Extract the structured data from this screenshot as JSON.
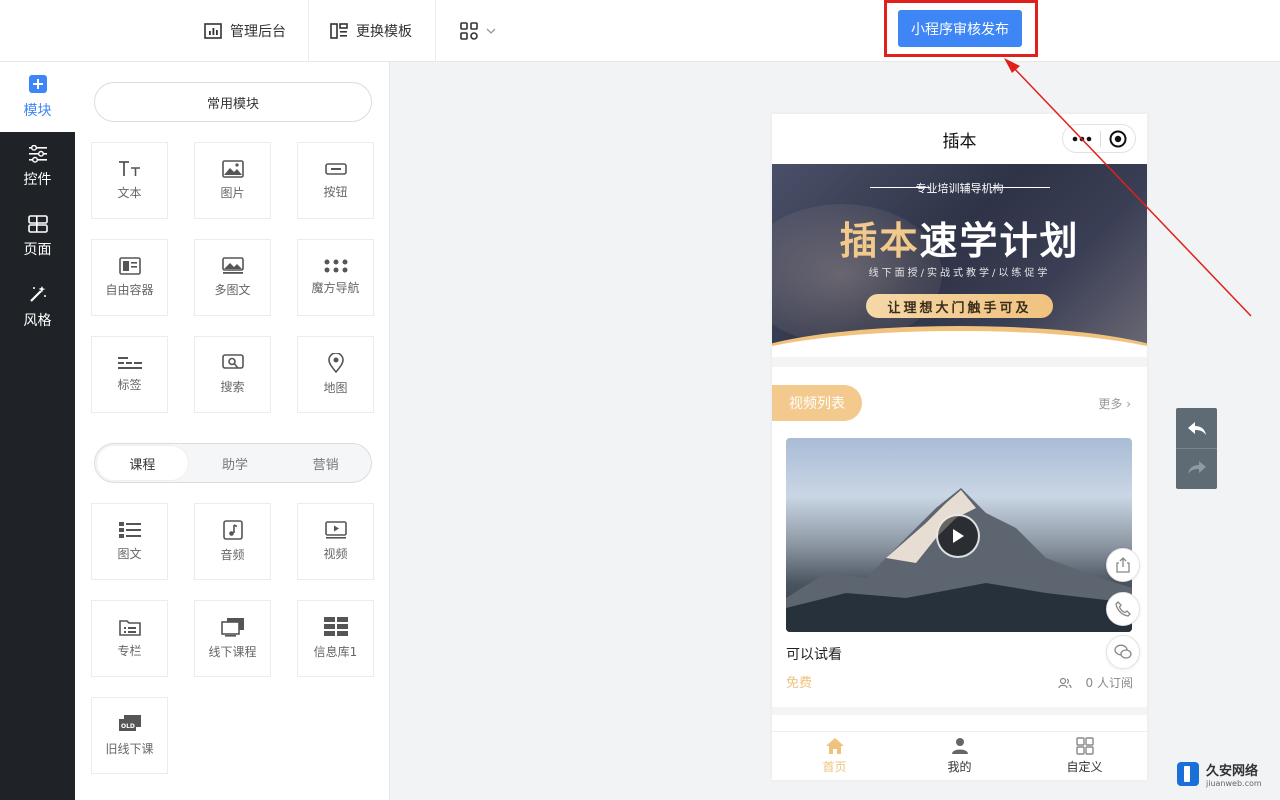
{
  "toolbar": {
    "admin_label": "管理后台",
    "template_label": "更换模板",
    "publish_label": "小程序审核发布"
  },
  "sidebar": {
    "items": [
      {
        "label": "模块",
        "icon": "plus-square-icon",
        "active": true
      },
      {
        "label": "控件",
        "icon": "sliders-icon"
      },
      {
        "label": "页面",
        "icon": "page-layout-icon"
      },
      {
        "label": "风格",
        "icon": "magic-wand-icon"
      }
    ]
  },
  "panel": {
    "common_title": "常用模块",
    "common_modules": [
      "文本",
      "图片",
      "按钮",
      "自由容器",
      "多图文",
      "魔方导航",
      "标签",
      "搜索",
      "地图"
    ],
    "tabs": [
      {
        "label": "课程",
        "active": true
      },
      {
        "label": "助学"
      },
      {
        "label": "营销"
      }
    ],
    "course_modules": [
      "图文",
      "音频",
      "视频",
      "专栏",
      "线下课程",
      "信息库1",
      "旧线下课"
    ]
  },
  "phone": {
    "title": "插本",
    "banner": {
      "subtitle": "专业培训辅导机构",
      "title_gold": "插本",
      "title_white": "速学计划",
      "desc": "线下面授/实战式教学/以练促学",
      "button": "让理想大门触手可及"
    },
    "section": {
      "tag": "视频列表",
      "more": "更多",
      "video_title": "可以试看",
      "price": "免费",
      "subscribers": "0 人订阅"
    },
    "tabbar": [
      {
        "label": "首页",
        "active": true
      },
      {
        "label": "我的"
      },
      {
        "label": "自定义"
      }
    ]
  },
  "watermark": {
    "name": "久安网络",
    "url": "jiuanweb.com"
  },
  "colors": {
    "accent": "#3e86f5",
    "highlight": "#e0201b",
    "gold": "#f0c27e",
    "sidebar_bg": "#1f2226"
  }
}
